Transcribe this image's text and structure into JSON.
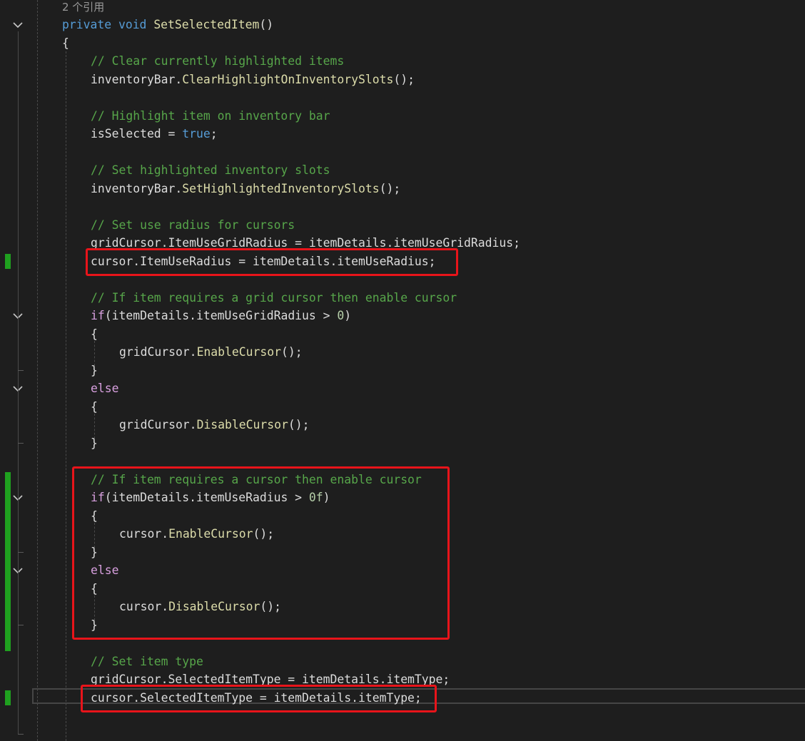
{
  "editor": {
    "colors": {
      "background": "#1e1e1e",
      "keyword": "#569cd6",
      "control_keyword": "#d8a0df",
      "comment": "#57a64a",
      "method": "#dcdcaa",
      "number": "#b5cea8",
      "plain": "#dcdcdc",
      "codelens": "#999999",
      "change_marker": "#1fa01f",
      "highlight_box": "#e8141a"
    },
    "codelens": "2 个引用",
    "lines": [
      {
        "i": 0,
        "indent": 0,
        "tokens": [
          [
            "ref",
            "2 个引用"
          ]
        ]
      },
      {
        "i": 1,
        "indent": 0,
        "tokens": [
          [
            "kw",
            "private"
          ],
          [
            "pl",
            " "
          ],
          [
            "kw",
            "void"
          ],
          [
            "pl",
            " "
          ],
          [
            "mt",
            "SetSelectedItem"
          ],
          [
            "pl",
            "()"
          ]
        ]
      },
      {
        "i": 2,
        "indent": 0,
        "tokens": [
          [
            "pl",
            "{"
          ]
        ]
      },
      {
        "i": 3,
        "indent": 1,
        "tokens": [
          [
            "cm",
            "// Clear currently highlighted items"
          ]
        ]
      },
      {
        "i": 4,
        "indent": 1,
        "tokens": [
          [
            "pl",
            "inventoryBar."
          ],
          [
            "mt",
            "ClearHighlightOnInventorySlots"
          ],
          [
            "pl",
            "();"
          ]
        ]
      },
      {
        "i": 6,
        "indent": 1,
        "tokens": [
          [
            "cm",
            "// Highlight item on inventory bar"
          ]
        ]
      },
      {
        "i": 7,
        "indent": 1,
        "tokens": [
          [
            "pl",
            "isSelected = "
          ],
          [
            "kw",
            "true"
          ],
          [
            "pl",
            ";"
          ]
        ]
      },
      {
        "i": 9,
        "indent": 1,
        "tokens": [
          [
            "cm",
            "// Set highlighted inventory slots"
          ]
        ]
      },
      {
        "i": 10,
        "indent": 1,
        "tokens": [
          [
            "pl",
            "inventoryBar."
          ],
          [
            "mt",
            "SetHighlightedInventorySlots"
          ],
          [
            "pl",
            "();"
          ]
        ]
      },
      {
        "i": 12,
        "indent": 1,
        "tokens": [
          [
            "cm",
            "// Set use radius for cursors"
          ]
        ]
      },
      {
        "i": 13,
        "indent": 1,
        "tokens": [
          [
            "pl",
            "gridCursor.ItemUseGridRadius = itemDetails.itemUseGridRadius;"
          ]
        ]
      },
      {
        "i": 14,
        "indent": 1,
        "tokens": [
          [
            "pl",
            "cursor.ItemUseRadius = itemDetails.itemUseRadius;"
          ]
        ]
      },
      {
        "i": 16,
        "indent": 1,
        "tokens": [
          [
            "cm",
            "// If item requires a grid cursor then enable cursor"
          ]
        ]
      },
      {
        "i": 17,
        "indent": 1,
        "tokens": [
          [
            "ctl",
            "if"
          ],
          [
            "pl",
            "(itemDetails.itemUseGridRadius > "
          ],
          [
            "num",
            "0"
          ],
          [
            "pl",
            ")"
          ]
        ]
      },
      {
        "i": 18,
        "indent": 1,
        "tokens": [
          [
            "pl",
            "{"
          ]
        ]
      },
      {
        "i": 19,
        "indent": 2,
        "tokens": [
          [
            "pl",
            "gridCursor."
          ],
          [
            "mt",
            "EnableCursor"
          ],
          [
            "pl",
            "();"
          ]
        ]
      },
      {
        "i": 20,
        "indent": 1,
        "tokens": [
          [
            "pl",
            "}"
          ]
        ]
      },
      {
        "i": 21,
        "indent": 1,
        "tokens": [
          [
            "ctl",
            "else"
          ]
        ]
      },
      {
        "i": 22,
        "indent": 1,
        "tokens": [
          [
            "pl",
            "{"
          ]
        ]
      },
      {
        "i": 23,
        "indent": 2,
        "tokens": [
          [
            "pl",
            "gridCursor."
          ],
          [
            "mt",
            "DisableCursor"
          ],
          [
            "pl",
            "();"
          ]
        ]
      },
      {
        "i": 24,
        "indent": 1,
        "tokens": [
          [
            "pl",
            "}"
          ]
        ]
      },
      {
        "i": 26,
        "indent": 1,
        "tokens": [
          [
            "cm",
            "// If item requires a cursor then enable cursor"
          ]
        ]
      },
      {
        "i": 27,
        "indent": 1,
        "tokens": [
          [
            "ctl",
            "if"
          ],
          [
            "pl",
            "(itemDetails.itemUseRadius > "
          ],
          [
            "num",
            "0f"
          ],
          [
            "pl",
            ")"
          ]
        ]
      },
      {
        "i": 28,
        "indent": 1,
        "tokens": [
          [
            "pl",
            "{"
          ]
        ]
      },
      {
        "i": 29,
        "indent": 2,
        "tokens": [
          [
            "pl",
            "cursor."
          ],
          [
            "mt",
            "EnableCursor"
          ],
          [
            "pl",
            "();"
          ]
        ]
      },
      {
        "i": 30,
        "indent": 1,
        "tokens": [
          [
            "pl",
            "}"
          ]
        ]
      },
      {
        "i": 31,
        "indent": 1,
        "tokens": [
          [
            "ctl",
            "else"
          ]
        ]
      },
      {
        "i": 32,
        "indent": 1,
        "tokens": [
          [
            "pl",
            "{"
          ]
        ]
      },
      {
        "i": 33,
        "indent": 2,
        "tokens": [
          [
            "pl",
            "cursor."
          ],
          [
            "mt",
            "DisableCursor"
          ],
          [
            "pl",
            "();"
          ]
        ]
      },
      {
        "i": 34,
        "indent": 1,
        "tokens": [
          [
            "pl",
            "}"
          ]
        ]
      },
      {
        "i": 36,
        "indent": 1,
        "tokens": [
          [
            "cm",
            "// Set item type"
          ]
        ]
      },
      {
        "i": 37,
        "indent": 1,
        "tokens": [
          [
            "pl",
            "gridCursor.SelectedItemType = itemDetails.itemType;"
          ]
        ]
      },
      {
        "i": 38,
        "indent": 1,
        "tokens": [
          [
            "pl",
            "cursor.SelectedItemType = itemDetails.itemType;"
          ]
        ]
      }
    ],
    "folds": [
      1,
      17,
      21,
      27,
      31
    ],
    "changed_lines": [
      14,
      26,
      27,
      28,
      29,
      30,
      31,
      32,
      33,
      34,
      35,
      38
    ],
    "highlighted_ranges": [
      [
        14,
        14
      ],
      [
        26,
        34
      ],
      [
        38,
        38
      ]
    ]
  }
}
